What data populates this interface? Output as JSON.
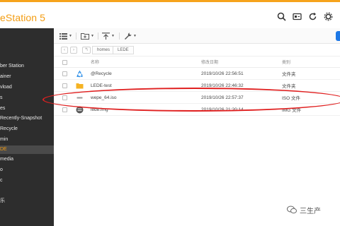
{
  "app": {
    "title": "eStation 5",
    "accent_color": "#f6a31c"
  },
  "top_icons": [
    "search-icon",
    "media-icon",
    "refresh-icon",
    "settings-icon"
  ],
  "sidebar": {
    "items": [
      {
        "label": "ber Station",
        "active": false
      },
      {
        "label": "ainer",
        "active": false
      },
      {
        "label": "vload",
        "active": false
      },
      {
        "label": "s",
        "active": false
      },
      {
        "label": "es",
        "active": false
      },
      {
        "label": "Recently-Snapshot",
        "active": false
      },
      {
        "label": "Recycle",
        "active": false
      },
      {
        "label": "min",
        "active": false
      },
      {
        "label": "DE",
        "active": true
      },
      {
        "label": "media",
        "active": false
      },
      {
        "label": "o",
        "active": false
      },
      {
        "label": "c",
        "active": false
      },
      {
        "label": "乐",
        "active": false
      }
    ]
  },
  "toolbar": {
    "buttons": [
      "view-list-icon",
      "new-folder-icon",
      "upload-icon",
      "tools-icon"
    ]
  },
  "breadcrumb": {
    "parts": [
      "homes",
      "LEDE"
    ]
  },
  "table": {
    "columns": {
      "name": "名称",
      "date": "修改日期",
      "type": "类别"
    },
    "rows": [
      {
        "icon": "recycle-icon",
        "name": "@Recycle",
        "date": "2019/10/26 22:56:51",
        "type": "文件夹"
      },
      {
        "icon": "folder-icon",
        "name": "LEDE-test",
        "date": "2019/10/26 22:46:32",
        "type": "文件夹"
      },
      {
        "icon": "iso-file-icon",
        "name": "wepe_64.iso",
        "date": "2019/10/26 22:57:37",
        "type": "ISO 文件"
      },
      {
        "icon": "disk-image-icon",
        "name": "lede.img",
        "date": "2019/10/26 21:20:14",
        "type": "IMG 文件"
      }
    ]
  },
  "watermark": {
    "text": "三生产"
  },
  "colors": {
    "highlight": "#e02020",
    "active_item": "#f39c12",
    "folder": "#f5b323",
    "recycle": "#2b8ee8"
  }
}
